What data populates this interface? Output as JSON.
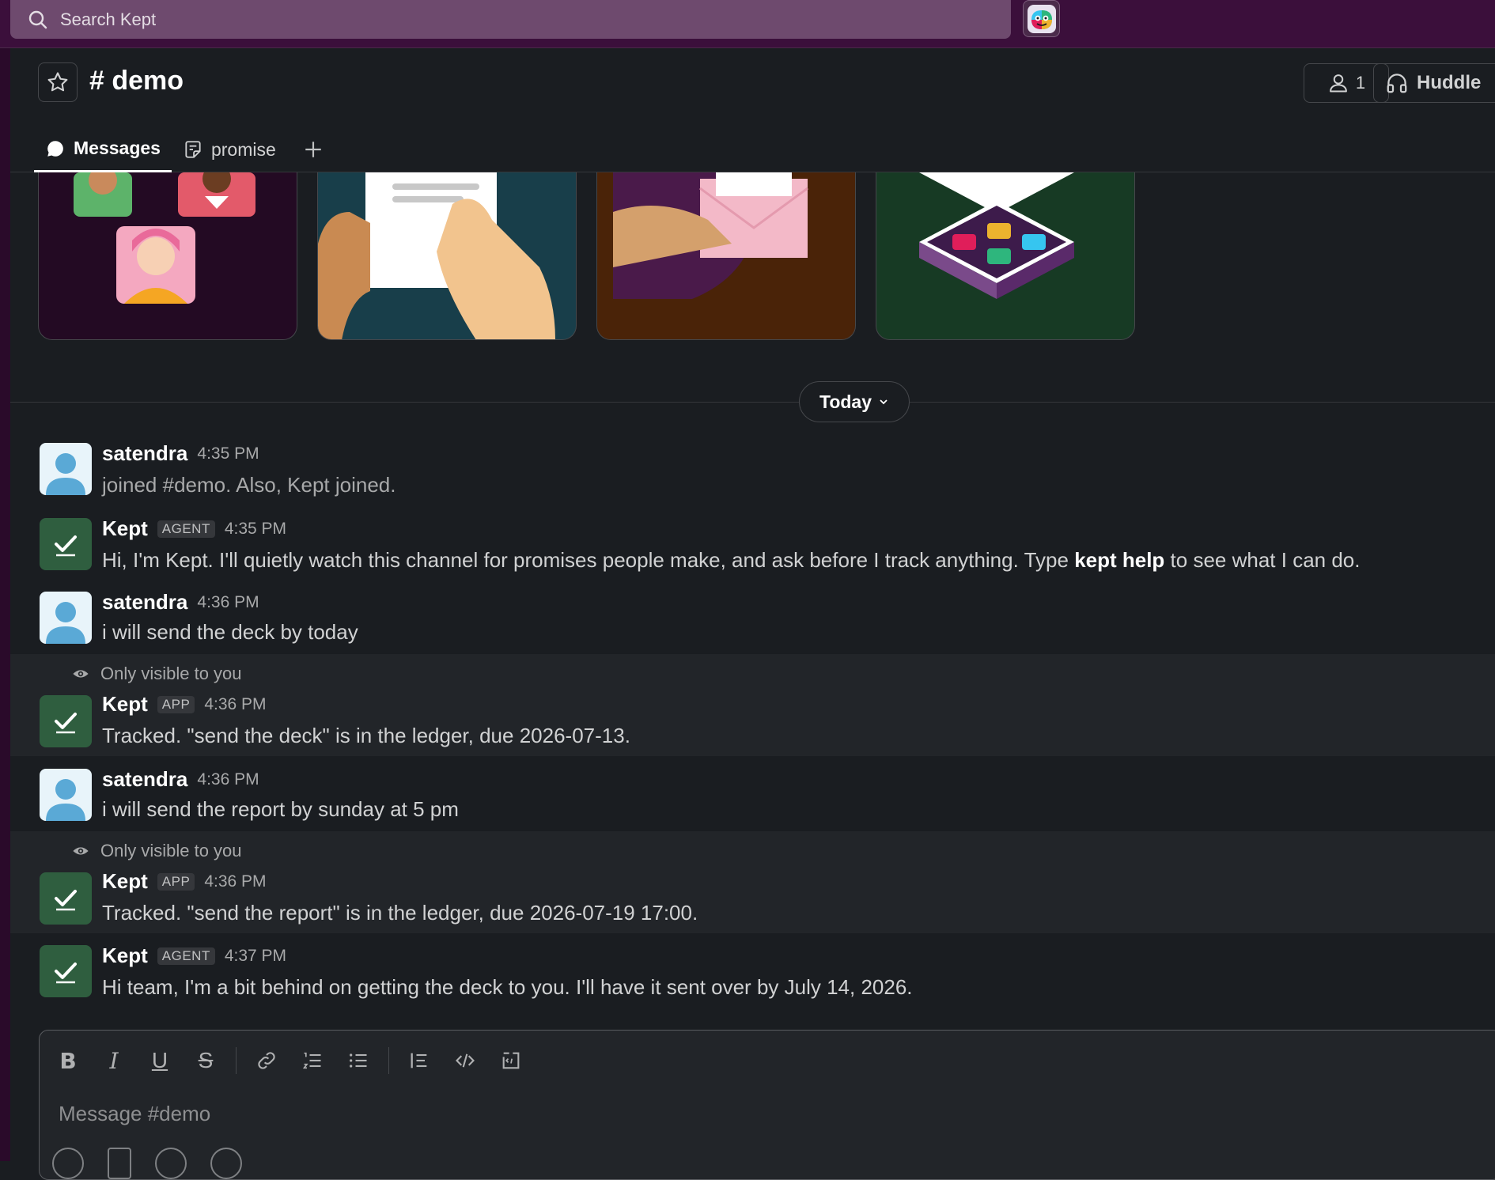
{
  "search": {
    "placeholder": "Search Kept"
  },
  "channel": {
    "name": "# demo"
  },
  "header": {
    "member_count": "1",
    "huddle_label": "Huddle"
  },
  "tabs": [
    {
      "label": "Messages",
      "active": true
    },
    {
      "label": "promise",
      "active": false
    }
  ],
  "divider": {
    "label": "Today"
  },
  "messages": [
    {
      "user": "satendra",
      "badge": "",
      "time": "4:35 PM",
      "text": "joined #demo. Also, Kept joined.",
      "kind": "user"
    },
    {
      "user": "Kept",
      "badge": "AGENT",
      "time": "4:35 PM",
      "text_pre": "Hi, I'm Kept. I'll quietly watch this channel for promises people make, and ask before I track anything. Type ",
      "text_bold": "kept help",
      "text_post": " to see what I can do.",
      "kind": "kept"
    },
    {
      "user": "satendra",
      "badge": "",
      "time": "4:36 PM",
      "text": "i will send the deck by today",
      "kind": "user"
    },
    {
      "note": "Only visible to you",
      "user": "Kept",
      "badge": "APP",
      "time": "4:36 PM",
      "text": "Tracked. \"send the deck\" is in the ledger, due 2026-07-13.",
      "kind": "kept"
    },
    {
      "user": "satendra",
      "badge": "",
      "time": "4:36 PM",
      "text": "i will send the report by sunday at 5 pm",
      "kind": "user"
    },
    {
      "note": "Only visible to you",
      "user": "Kept",
      "badge": "APP",
      "time": "4:36 PM",
      "text": "Tracked. \"send the report\" is in the ledger, due 2026-07-19 17:00.",
      "kind": "kept"
    },
    {
      "user": "Kept",
      "badge": "AGENT",
      "time": "4:37 PM",
      "text": "Hi team, I'm a bit behind on getting the deck to you. I'll have it sent over by July 14, 2026.",
      "kind": "kept"
    }
  ],
  "composer": {
    "placeholder": "Message #demo"
  },
  "colors": {
    "topbar": "#3b0f3b",
    "search": "#6e4a6e",
    "background": "#1a1d21",
    "kept_avatar": "#2f5e3f",
    "ephemeral_bg": "#222529"
  }
}
